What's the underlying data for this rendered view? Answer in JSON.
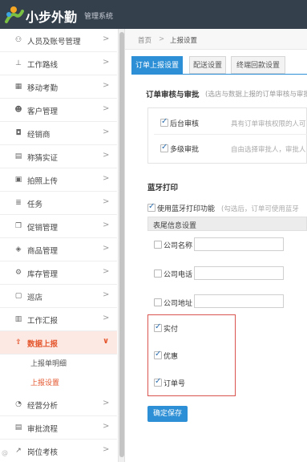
{
  "header": {
    "logo_text": "小步外勤",
    "logo_sub": "管理系统"
  },
  "sidebar": {
    "items": [
      {
        "label": "人员及账号管理",
        "icon": "org-icon",
        "glyph": "⚇"
      },
      {
        "label": "工作路线",
        "icon": "pin-icon",
        "glyph": "⊥"
      },
      {
        "label": "移动考勤",
        "icon": "calendar-icon",
        "glyph": "▦"
      },
      {
        "label": "客户管理",
        "icon": "customer-icon",
        "glyph": "☻"
      },
      {
        "label": "经销商",
        "icon": "dealer-icon",
        "glyph": "◘"
      },
      {
        "label": "称猜实证",
        "icon": "doc-icon",
        "glyph": "▤"
      },
      {
        "label": "拍照上传",
        "icon": "photo-icon",
        "glyph": "▣"
      },
      {
        "label": "任务",
        "icon": "task-icon",
        "glyph": "≣"
      },
      {
        "label": "促销管理",
        "icon": "promo-icon",
        "glyph": "❐"
      },
      {
        "label": "商品管理",
        "icon": "product-icon",
        "glyph": "◈"
      },
      {
        "label": "库存管理",
        "icon": "stock-icon",
        "glyph": "⚙"
      },
      {
        "label": "巡店",
        "icon": "store-icon",
        "glyph": "▢"
      },
      {
        "label": "工作汇报",
        "icon": "report-icon",
        "glyph": "▥"
      },
      {
        "label": "数据上报",
        "icon": "upload-icon",
        "glyph": "⇪"
      },
      {
        "label": "经营分析",
        "icon": "analysis-icon",
        "glyph": "◔"
      },
      {
        "label": "审批流程",
        "icon": "approval-icon",
        "glyph": "▤"
      },
      {
        "label": "岗位考核",
        "icon": "assess-icon",
        "glyph": "↗"
      }
    ],
    "chevron_right": ">",
    "chevron_down": "∨",
    "sub_items": [
      "上报单明细",
      "上报设置"
    ]
  },
  "breadcrumb": {
    "home": "首页",
    "sep": ">",
    "current": "上报设置"
  },
  "tabs": [
    "订单上报设置",
    "配送设置",
    "终端回款设置"
  ],
  "audit": {
    "title": "订单审核与审批",
    "desc": "(选店与数据上报的订单审核与审批",
    "backend": {
      "label": "后台审核",
      "hint": "具有订单审核权限的人可"
    },
    "multi": {
      "label": "多级审批",
      "hint": "自由选择审批人，审批人"
    }
  },
  "bluetooth": {
    "title": "蓝牙打印",
    "enable_label": "使用蓝牙打印功能",
    "enable_hint": "(勾选后，订单可使用蓝牙"
  },
  "tail": {
    "header": "表尾信息设置",
    "company_name": "公司名称",
    "company_phone": "公司电话",
    "company_address": "公司地址",
    "paid": "实付",
    "discount": "优惠",
    "order_no": "订单号"
  },
  "save_label": "确定保存",
  "watermark": "@"
}
